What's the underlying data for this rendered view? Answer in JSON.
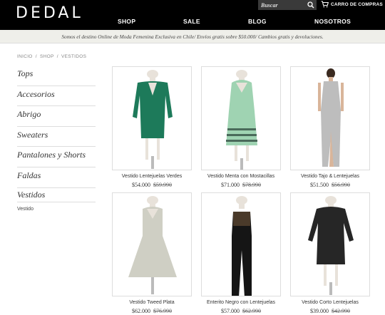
{
  "brand": {
    "name": "DEDAL"
  },
  "search": {
    "placeholder": "Buscar"
  },
  "cart": {
    "label": "CARRO DE COMPRAS"
  },
  "nav": [
    {
      "label": "SHOP"
    },
    {
      "label": "SALE"
    },
    {
      "label": "BLOG"
    },
    {
      "label": "NOSOTROS"
    }
  ],
  "banner": {
    "text": "Somos el destino Online de Moda Femenina Exclusiva en Chile/ Envíos gratis sobre $50.000/ Cambios gratis y devoluciones."
  },
  "breadcrumb": [
    "INICIO",
    "/",
    "SHOP",
    "/",
    "VESTIDOS"
  ],
  "sidebar": {
    "items": [
      {
        "label": "Tops"
      },
      {
        "label": "Accesorios"
      },
      {
        "label": "Abrigo"
      },
      {
        "label": "Sweaters"
      },
      {
        "label": "Pantalones y Shorts"
      },
      {
        "label": "Faldas"
      },
      {
        "label": "Vestidos"
      }
    ],
    "sub": "Vestido"
  },
  "products": [
    {
      "name": "Vestido Lentejuelas Verdes",
      "price": "$54.000",
      "old_price": "$59.990",
      "color": "#1d7a5a"
    },
    {
      "name": "Vestido Menta con Mostacillas",
      "price": "$71.000",
      "old_price": "$78.990",
      "color": "#9fd3b2"
    },
    {
      "name": "Vestido Tajo & Lentejuelas",
      "price": "$51.500",
      "old_price": "$56.990",
      "color": "#bdbdbd"
    },
    {
      "name": "Vestido Tweed Plata",
      "price": "$62.000",
      "old_price": "$76.990",
      "color": "#cfcfc4"
    },
    {
      "name": "Enterito Negro con Lentejuelas",
      "price": "$57.000",
      "old_price": "$62.990",
      "color": "#151515"
    },
    {
      "name": "Vestido Corto Lentejuelas",
      "price": "$39.000",
      "old_price": "$42.990",
      "color": "#262626"
    }
  ]
}
